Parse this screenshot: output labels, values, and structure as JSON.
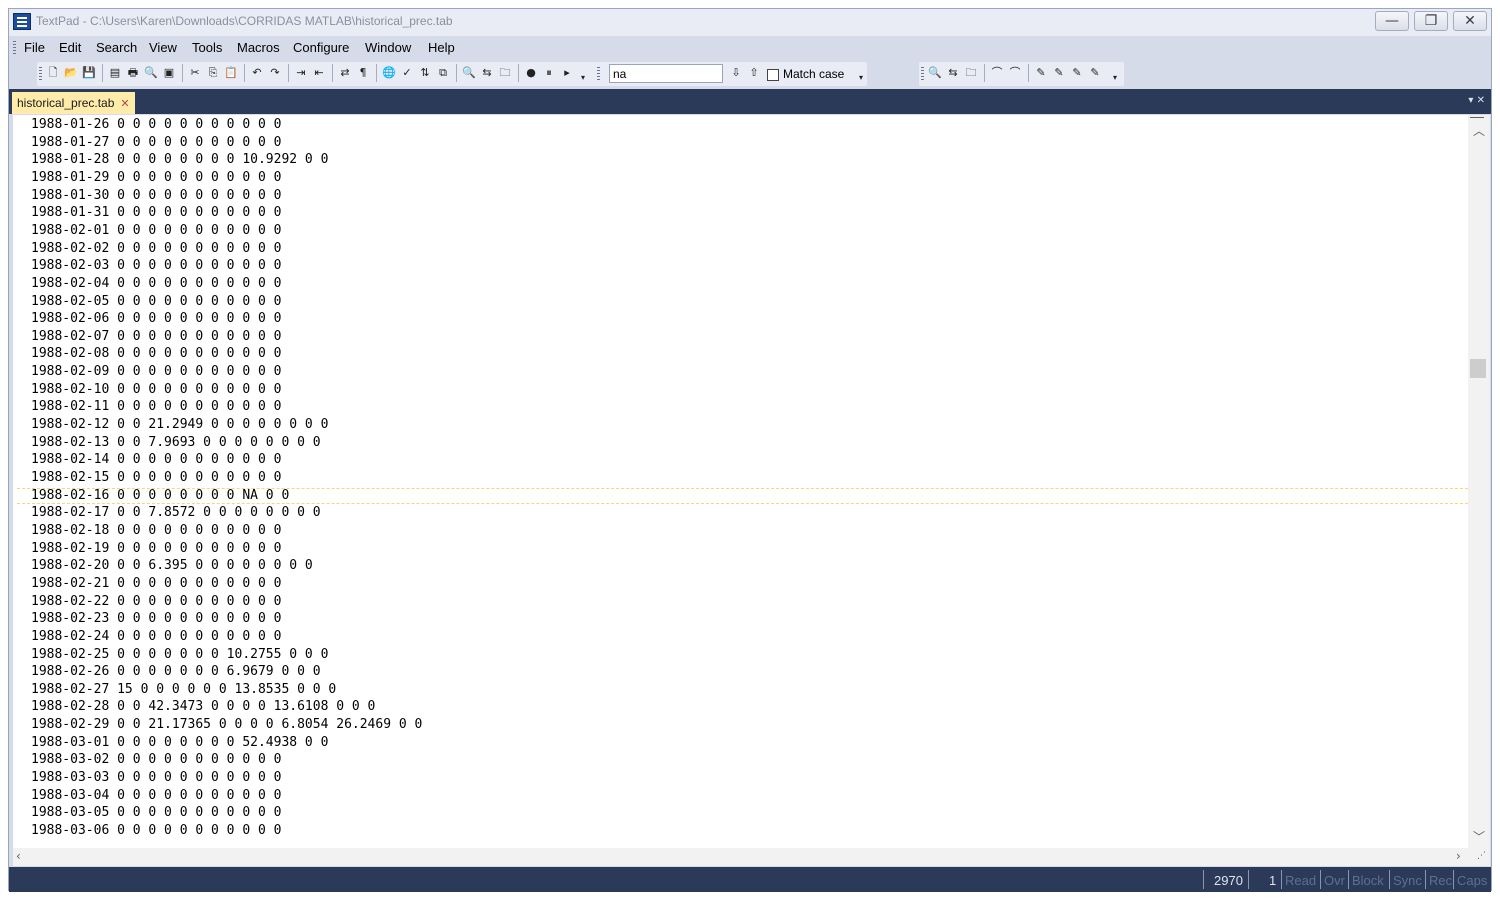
{
  "window": {
    "title": "TextPad - C:\\Users\\Karen\\Downloads\\CORRIDAS MATLAB\\historical_prec.tab",
    "minimize_glyph": "—",
    "restore_glyph": "❐",
    "close_glyph": "✕"
  },
  "menu": [
    "File",
    "Edit",
    "Search",
    "View",
    "Tools",
    "Macros",
    "Configure",
    "Window",
    "Help"
  ],
  "toolbar": {
    "find_value": "na",
    "match_case_label": "Match case"
  },
  "tab": {
    "label": "historical_prec.tab",
    "close_glyph": "✕"
  },
  "tab_controls": "▾ ✕",
  "editor": {
    "current_line_index": 21,
    "lines": [
      "1988-01-26 0 0 0 0 0 0 0 0 0 0 0",
      "1988-01-27 0 0 0 0 0 0 0 0 0 0 0",
      "1988-01-28 0 0 0 0 0 0 0 0 10.9292 0 0",
      "1988-01-29 0 0 0 0 0 0 0 0 0 0 0",
      "1988-01-30 0 0 0 0 0 0 0 0 0 0 0",
      "1988-01-31 0 0 0 0 0 0 0 0 0 0 0",
      "1988-02-01 0 0 0 0 0 0 0 0 0 0 0",
      "1988-02-02 0 0 0 0 0 0 0 0 0 0 0",
      "1988-02-03 0 0 0 0 0 0 0 0 0 0 0",
      "1988-02-04 0 0 0 0 0 0 0 0 0 0 0",
      "1988-02-05 0 0 0 0 0 0 0 0 0 0 0",
      "1988-02-06 0 0 0 0 0 0 0 0 0 0 0",
      "1988-02-07 0 0 0 0 0 0 0 0 0 0 0",
      "1988-02-08 0 0 0 0 0 0 0 0 0 0 0",
      "1988-02-09 0 0 0 0 0 0 0 0 0 0 0",
      "1988-02-10 0 0 0 0 0 0 0 0 0 0 0",
      "1988-02-11 0 0 0 0 0 0 0 0 0 0 0",
      "1988-02-12 0 0 21.2949 0 0 0 0 0 0 0 0",
      "1988-02-13 0 0 7.9693 0 0 0 0 0 0 0 0",
      "1988-02-14 0 0 0 0 0 0 0 0 0 0 0",
      "1988-02-15 0 0 0 0 0 0 0 0 0 0 0",
      "1988-02-16 0 0 0 0 0 0 0 0 NA 0 0",
      "1988-02-17 0 0 7.8572 0 0 0 0 0 0 0 0",
      "1988-02-18 0 0 0 0 0 0 0 0 0 0 0",
      "1988-02-19 0 0 0 0 0 0 0 0 0 0 0",
      "1988-02-20 0 0 6.395 0 0 0 0 0 0 0 0",
      "1988-02-21 0 0 0 0 0 0 0 0 0 0 0",
      "1988-02-22 0 0 0 0 0 0 0 0 0 0 0",
      "1988-02-23 0 0 0 0 0 0 0 0 0 0 0",
      "1988-02-24 0 0 0 0 0 0 0 0 0 0 0",
      "1988-02-25 0 0 0 0 0 0 0 10.2755 0 0 0",
      "1988-02-26 0 0 0 0 0 0 0 6.9679 0 0 0",
      "1988-02-27 15 0 0 0 0 0 0 13.8535 0 0 0",
      "1988-02-28 0 0 42.3473 0 0 0 0 13.6108 0 0 0",
      "1988-02-29 0 0 21.17365 0 0 0 0 6.8054 26.2469 0 0",
      "1988-03-01 0 0 0 0 0 0 0 0 52.4938 0 0",
      "1988-03-02 0 0 0 0 0 0 0 0 0 0 0",
      "1988-03-03 0 0 0 0 0 0 0 0 0 0 0",
      "1988-03-04 0 0 0 0 0 0 0 0 0 0 0",
      "1988-03-05 0 0 0 0 0 0 0 0 0 0 0",
      "1988-03-06 0 0 0 0 0 0 0 0 0 0 0"
    ]
  },
  "status": {
    "line": "2970",
    "column": "1",
    "indicators": [
      "Read",
      "Ovr",
      "Block",
      "Sync",
      "Rec",
      "Caps"
    ]
  }
}
